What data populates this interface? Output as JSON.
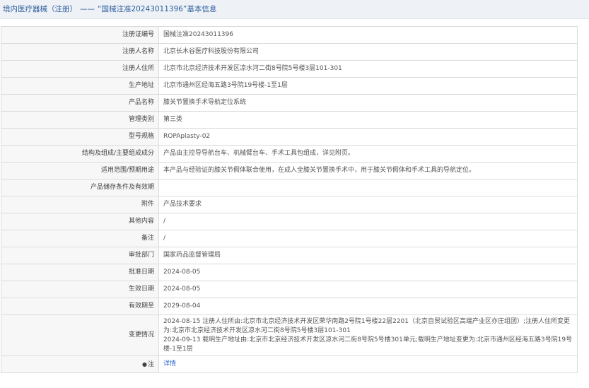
{
  "header": {
    "category": "境内医疗器械（注册）",
    "dash": "——",
    "title": "“国械注准20243011396”基本信息"
  },
  "rows": [
    {
      "label": "注册证编号",
      "value": "国械注准20243011396"
    },
    {
      "label": "注册人名称",
      "value": "北京长木谷医疗科技股份有限公司"
    },
    {
      "label": "注册人住所",
      "value": "北京市北京经济技术开发区凉水河二街8号院5号楼3层101-301"
    },
    {
      "label": "生产地址",
      "value": "北京市通州区经海五路3号院19号楼-1至1层"
    },
    {
      "label": "产品名称",
      "value": "膝关节置换手术导航定位系统"
    },
    {
      "label": "管理类别",
      "value": "第三类"
    },
    {
      "label": "型号规格",
      "value": "ROPAplasty-02"
    },
    {
      "label": "结构及组成/主要组成成分",
      "value": "产品由主控导导航台车、机械臂台车、手术工具包组成，详见附页。"
    },
    {
      "label": "适用范围/预期用途",
      "value": "本产品与经验证的膝关节假体联合使用，在成人全膝关节置换手术中，用于膝关节假体和手术工具的导航定位。"
    },
    {
      "label": "产品储存条件及有效期",
      "value": ""
    },
    {
      "label": "附件",
      "value": "产品技术要求"
    },
    {
      "label": "其他内容",
      "value": "/"
    },
    {
      "label": "备注",
      "value": "/"
    },
    {
      "label": "审批部门",
      "value": "国家药品监督管理局"
    },
    {
      "label": "批准日期",
      "value": "2024-08-05"
    },
    {
      "label": "生效日期",
      "value": "2024-08-05"
    },
    {
      "label": "有效期至",
      "value": "2029-08-04"
    }
  ],
  "changes": {
    "label": "变更情况",
    "line1": "2024-08-15 注册人住所由:北京市北京经济技术开发区荣华南路2号院1号楼22层2201（北京自贸试验区高端产业区亦庄组团）;注册人住所变更为:北京市北京经济技术开发区凉水河二街8号院5号楼3层101-301",
    "line2": "2024-09-13 载明生产地址由:北京市北京经济技术开发区凉水河二街8号院5号楼301单元;载明生产地址变更为:北京市通州区经海五路3号院19号楼-1至1层"
  },
  "note": {
    "label": "注",
    "dot": "●",
    "link": "详情"
  }
}
